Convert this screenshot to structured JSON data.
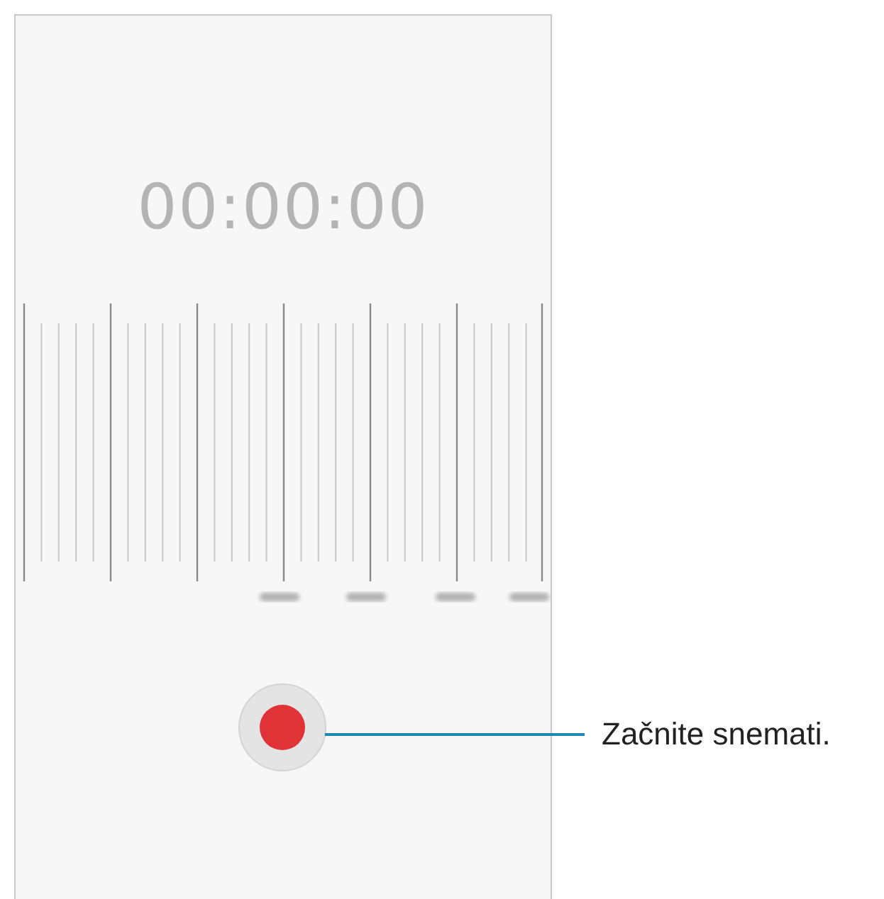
{
  "screen": {
    "timer": "00:00:00"
  },
  "callout": {
    "text": "Začnite snemati."
  }
}
